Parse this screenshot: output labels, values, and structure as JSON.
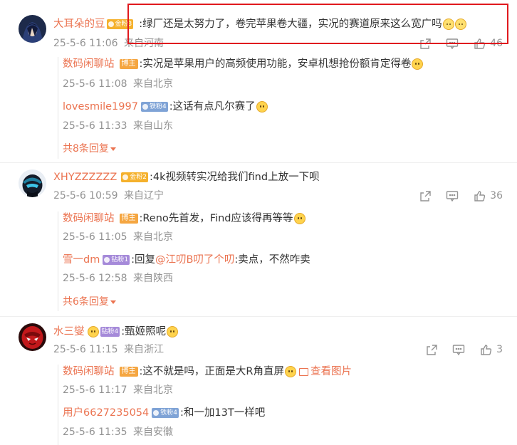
{
  "comments": [
    {
      "user": "大耳朵的豆",
      "badge": "金粉3",
      "text": ":绿厂还是太努力了，卷完苹果卷大疆，实况的赛道原来这么宽广吗",
      "time": "25-5-6 11:06",
      "location": "来自河南",
      "likes": "46",
      "replies": [
        {
          "user": "数码闲聊站",
          "badge": "博主",
          "text": ":实况是苹果用户的高频使用功能，安卓机想抢份额肯定得卷",
          "time": "25-5-6 11:08",
          "location": "来自北京"
        },
        {
          "user": "lovesmile1997",
          "badge": "铁粉4",
          "text": ":这话有点凡尔赛了",
          "time": "25-5-6 11:33",
          "location": "来自山东"
        }
      ],
      "more_replies": "共8条回复"
    },
    {
      "user": "XHYZZZZZZ",
      "badge": "金粉2",
      "text": ":4k视频转实况给我们find上放一下呗",
      "time": "25-5-6 10:59",
      "location": "来自辽宁",
      "likes": "36",
      "replies": [
        {
          "user": "数码闲聊站",
          "badge": "博主",
          "text": ":Reno先首发，Find应该得再等等",
          "time": "25-5-6 11:05",
          "location": "来自北京"
        },
        {
          "user": "雪一dm",
          "badge": "钻粉1",
          "text_prefix": ":回复",
          "mention": "@江叨B叨了个叨",
          "text": ":卖点，不然咋卖",
          "time": "25-5-6 12:58",
          "location": "来自陕西"
        }
      ],
      "more_replies": "共6条回复"
    },
    {
      "user": "水三燮",
      "badge": "钻粉4",
      "text": ":甄姬照呢",
      "time": "25-5-6 11:15",
      "location": "来自浙江",
      "likes": "3",
      "replies": [
        {
          "user": "数码闲聊站",
          "badge": "博主",
          "text": ":这不就是吗，正面是大R角直屏",
          "view_pic": "查看图片",
          "time": "25-5-6 11:17",
          "location": "来自北京"
        },
        {
          "user": "用户6627235054",
          "badge": "铁粉4",
          "text": ":和一加13T一样吧",
          "time": "25-5-6 11:35",
          "location": "来自安徽"
        }
      ]
    }
  ],
  "colors": {
    "accent": "#eb7350",
    "meta": "#939393",
    "highlight": "#e0191e"
  },
  "icons": [
    "share-icon",
    "comment-icon",
    "like-icon",
    "emoji-icon",
    "image-icon"
  ]
}
